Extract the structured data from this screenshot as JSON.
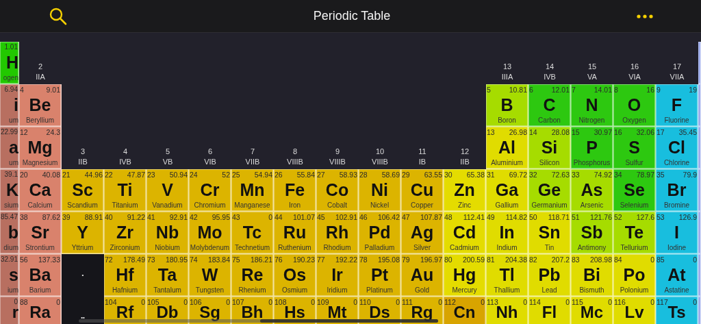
{
  "top_bar": {
    "title": "Periodic Table"
  },
  "rows": [
    {
      "cells": [
        {
          "kind": "edge",
          "mass": "1.01",
          "symbol": "H",
          "name": "ogen",
          "color": "#22c800"
        },
        {
          "kind": "label",
          "number": "2",
          "roman": "IIA"
        },
        {
          "kind": "gap"
        },
        {
          "kind": "gap"
        },
        {
          "kind": "gap"
        },
        {
          "kind": "gap"
        },
        {
          "kind": "gap"
        },
        {
          "kind": "gap"
        },
        {
          "kind": "gap"
        },
        {
          "kind": "gap"
        },
        {
          "kind": "gap"
        },
        {
          "kind": "gap"
        },
        {
          "kind": "label",
          "number": "13",
          "roman": "IIIA"
        },
        {
          "kind": "label",
          "number": "14",
          "roman": "IVB"
        },
        {
          "kind": "label",
          "number": "15",
          "roman": "VA"
        },
        {
          "kind": "label",
          "number": "16",
          "roman": "VIA"
        },
        {
          "kind": "label",
          "number": "17",
          "roman": "VIIA"
        },
        {
          "kind": "sliver",
          "color": "#8a9ce8"
        }
      ]
    },
    {
      "cells": [
        {
          "kind": "edge",
          "mass": "6.94",
          "symbol": "i",
          "name": "um",
          "color": "#b86f60"
        },
        {
          "kind": "element",
          "number": "4",
          "mass": "9.01",
          "symbol": "Be",
          "name": "Beryllium",
          "color": "#d9826c"
        },
        {
          "kind": "gap"
        },
        {
          "kind": "gap"
        },
        {
          "kind": "gap"
        },
        {
          "kind": "gap"
        },
        {
          "kind": "gap"
        },
        {
          "kind": "gap"
        },
        {
          "kind": "gap"
        },
        {
          "kind": "gap"
        },
        {
          "kind": "gap"
        },
        {
          "kind": "gap"
        },
        {
          "kind": "element",
          "number": "5",
          "mass": "10.81",
          "symbol": "B",
          "name": "Boron",
          "color": "#a6dc00"
        },
        {
          "kind": "element",
          "number": "6",
          "mass": "12.01",
          "symbol": "C",
          "name": "Carbon",
          "color": "#2dc810"
        },
        {
          "kind": "element",
          "number": "7",
          "mass": "14.01",
          "symbol": "N",
          "name": "Nitrogen",
          "color": "#2dc810"
        },
        {
          "kind": "element",
          "number": "8",
          "mass": "16",
          "symbol": "O",
          "name": "Oxygen",
          "color": "#2dc810"
        },
        {
          "kind": "element",
          "number": "9",
          "mass": "19",
          "symbol": "F",
          "name": "Fluorine",
          "color": "#18bede"
        },
        {
          "kind": "sliver",
          "color": "#8a9ce8"
        }
      ]
    },
    {
      "cells": [
        {
          "kind": "edge",
          "mass": "22.99",
          "symbol": "a",
          "name": "um",
          "color": "#b86f60"
        },
        {
          "kind": "element",
          "number": "12",
          "mass": "24.3",
          "symbol": "Mg",
          "name": "Magnesium",
          "color": "#d9826c"
        },
        {
          "kind": "label",
          "number": "3",
          "roman": "IIB"
        },
        {
          "kind": "label",
          "number": "4",
          "roman": "IVB"
        },
        {
          "kind": "label",
          "number": "5",
          "roman": "VB"
        },
        {
          "kind": "label",
          "number": "6",
          "roman": "VIB"
        },
        {
          "kind": "label",
          "number": "7",
          "roman": "VIIB"
        },
        {
          "kind": "label",
          "number": "8",
          "roman": "VIIIB"
        },
        {
          "kind": "label",
          "number": "9",
          "roman": "VIIIB"
        },
        {
          "kind": "label",
          "number": "10",
          "roman": "VIIIB"
        },
        {
          "kind": "label",
          "number": "11",
          "roman": "IB"
        },
        {
          "kind": "label",
          "number": "12",
          "roman": "IIB"
        },
        {
          "kind": "element",
          "number": "13",
          "mass": "26.98",
          "symbol": "Al",
          "name": "Aluminium",
          "color": "#e0dc00"
        },
        {
          "kind": "element",
          "number": "14",
          "mass": "28.08",
          "symbol": "Si",
          "name": "Silicon",
          "color": "#a6dc00"
        },
        {
          "kind": "element",
          "number": "15",
          "mass": "30.97",
          "symbol": "P",
          "name": "Phosphorus",
          "color": "#2dc810"
        },
        {
          "kind": "element",
          "number": "16",
          "mass": "32.06",
          "symbol": "S",
          "name": "Sulfur",
          "color": "#2dc810"
        },
        {
          "kind": "element",
          "number": "17",
          "mass": "35.45",
          "symbol": "Cl",
          "name": "Chlorine",
          "color": "#18bede"
        },
        {
          "kind": "sliver",
          "color": "#8a9ce8"
        }
      ]
    },
    {
      "cells": [
        {
          "kind": "edge",
          "mass": "39.1",
          "symbol": "K",
          "name": "sium",
          "color": "#b86f60"
        },
        {
          "kind": "element",
          "number": "20",
          "mass": "40.08",
          "symbol": "Ca",
          "name": "Calcium",
          "color": "#d9826c"
        },
        {
          "kind": "element",
          "number": "21",
          "mass": "44.96",
          "symbol": "Sc",
          "name": "Scandium",
          "color": "#dcb400"
        },
        {
          "kind": "element",
          "number": "22",
          "mass": "47.87",
          "symbol": "Ti",
          "name": "Titanium",
          "color": "#dcb400"
        },
        {
          "kind": "element",
          "number": "23",
          "mass": "50.94",
          "symbol": "V",
          "name": "Vanadium",
          "color": "#dcb400"
        },
        {
          "kind": "element",
          "number": "24",
          "mass": "52",
          "symbol": "Cr",
          "name": "Chromium",
          "color": "#dcb400"
        },
        {
          "kind": "element",
          "number": "25",
          "mass": "54.94",
          "symbol": "Mn",
          "name": "Manganese",
          "color": "#dcb400"
        },
        {
          "kind": "element",
          "number": "26",
          "mass": "55.84",
          "symbol": "Fe",
          "name": "Iron",
          "color": "#dcb400"
        },
        {
          "kind": "element",
          "number": "27",
          "mass": "58.93",
          "symbol": "Co",
          "name": "Cobalt",
          "color": "#dcb400"
        },
        {
          "kind": "element",
          "number": "28",
          "mass": "58.69",
          "symbol": "Ni",
          "name": "Nickel",
          "color": "#dcb400"
        },
        {
          "kind": "element",
          "number": "29",
          "mass": "63.55",
          "symbol": "Cu",
          "name": "Copper",
          "color": "#dcb400"
        },
        {
          "kind": "element",
          "number": "30",
          "mass": "65.38",
          "symbol": "Zn",
          "name": "Zinc",
          "color": "#e4dc00"
        },
        {
          "kind": "element",
          "number": "31",
          "mass": "69.72",
          "symbol": "Ga",
          "name": "Gallium",
          "color": "#e0dc00"
        },
        {
          "kind": "element",
          "number": "32",
          "mass": "72.63",
          "symbol": "Ge",
          "name": "Germanium",
          "color": "#a6dc00"
        },
        {
          "kind": "element",
          "number": "33",
          "mass": "74.92",
          "symbol": "As",
          "name": "Arsenic",
          "color": "#a6dc00"
        },
        {
          "kind": "element",
          "number": "34",
          "mass": "78.97",
          "symbol": "Se",
          "name": "Selenium",
          "color": "#2dc810"
        },
        {
          "kind": "element",
          "number": "35",
          "mass": "79.9",
          "symbol": "Br",
          "name": "Bromine",
          "color": "#18bede"
        },
        {
          "kind": "sliver",
          "color": "#8a9ce8"
        }
      ]
    },
    {
      "cells": [
        {
          "kind": "edge",
          "mass": "85.47",
          "symbol": "b",
          "name": "dium",
          "color": "#b86f60"
        },
        {
          "kind": "element",
          "number": "38",
          "mass": "87.62",
          "symbol": "Sr",
          "name": "Strontium",
          "color": "#d9826c"
        },
        {
          "kind": "element",
          "number": "39",
          "mass": "88.91",
          "symbol": "Y",
          "name": "Yttrium",
          "color": "#dcb400"
        },
        {
          "kind": "element",
          "number": "40",
          "mass": "91.22",
          "symbol": "Zr",
          "name": "Zirconium",
          "color": "#dcb400"
        },
        {
          "kind": "element",
          "number": "41",
          "mass": "92.91",
          "symbol": "Nb",
          "name": "Niobium",
          "color": "#dcb400"
        },
        {
          "kind": "element",
          "number": "42",
          "mass": "95.95",
          "symbol": "Mo",
          "name": "Molybdenum",
          "color": "#dcb400"
        },
        {
          "kind": "element",
          "number": "43",
          "mass": "0",
          "symbol": "Tc",
          "name": "Technetium",
          "color": "#dcb400"
        },
        {
          "kind": "element",
          "number": "44",
          "mass": "101.07",
          "symbol": "Ru",
          "name": "Ruthenium",
          "color": "#dcb400"
        },
        {
          "kind": "element",
          "number": "45",
          "mass": "102.91",
          "symbol": "Rh",
          "name": "Rhodium",
          "color": "#dcb400"
        },
        {
          "kind": "element",
          "number": "46",
          "mass": "106.42",
          "symbol": "Pd",
          "name": "Palladium",
          "color": "#dcb400"
        },
        {
          "kind": "element",
          "number": "47",
          "mass": "107.87",
          "symbol": "Ag",
          "name": "Silver",
          "color": "#dcb400"
        },
        {
          "kind": "element",
          "number": "48",
          "mass": "112.41",
          "symbol": "Cd",
          "name": "Cadmium",
          "color": "#e4dc00"
        },
        {
          "kind": "element",
          "number": "49",
          "mass": "114.82",
          "symbol": "In",
          "name": "Indium",
          "color": "#e0dc00"
        },
        {
          "kind": "element",
          "number": "50",
          "mass": "118.71",
          "symbol": "Sn",
          "name": "Tin",
          "color": "#e0dc00"
        },
        {
          "kind": "element",
          "number": "51",
          "mass": "121.76",
          "symbol": "Sb",
          "name": "Antimony",
          "color": "#a6dc00"
        },
        {
          "kind": "element",
          "number": "52",
          "mass": "127.6",
          "symbol": "Te",
          "name": "Tellurium",
          "color": "#a6dc00"
        },
        {
          "kind": "element",
          "number": "53",
          "mass": "126.9",
          "symbol": "I",
          "name": "Iodine",
          "color": "#18bede"
        },
        {
          "kind": "sliver",
          "color": "#8a9ce8"
        }
      ]
    },
    {
      "cells": [
        {
          "kind": "edge",
          "mass": "32.91",
          "symbol": "s",
          "name": "ium",
          "color": "#b86f60"
        },
        {
          "kind": "element",
          "number": "56",
          "mass": "137.33",
          "symbol": "Ba",
          "name": "Barium",
          "color": "#d9826c"
        },
        {
          "kind": "placeholder",
          "mark": "•"
        },
        {
          "kind": "element",
          "number": "72",
          "mass": "178.49",
          "symbol": "Hf",
          "name": "Hafnium",
          "color": "#dcb400"
        },
        {
          "kind": "element",
          "number": "73",
          "mass": "180.95",
          "symbol": "Ta",
          "name": "Tantalum",
          "color": "#dcb400"
        },
        {
          "kind": "element",
          "number": "74",
          "mass": "183.84",
          "symbol": "W",
          "name": "Tungsten",
          "color": "#dcb400"
        },
        {
          "kind": "element",
          "number": "75",
          "mass": "186.21",
          "symbol": "Re",
          "name": "Rhenium",
          "color": "#dcb400"
        },
        {
          "kind": "element",
          "number": "76",
          "mass": "190.23",
          "symbol": "Os",
          "name": "Osmium",
          "color": "#dcb400"
        },
        {
          "kind": "element",
          "number": "77",
          "mass": "192.22",
          "symbol": "Ir",
          "name": "Iridium",
          "color": "#dcb400"
        },
        {
          "kind": "element",
          "number": "78",
          "mass": "195.08",
          "symbol": "Pt",
          "name": "Platinum",
          "color": "#dcb400"
        },
        {
          "kind": "element",
          "number": "79",
          "mass": "196.97",
          "symbol": "Au",
          "name": "Gold",
          "color": "#dcb400"
        },
        {
          "kind": "element",
          "number": "80",
          "mass": "200.59",
          "symbol": "Hg",
          "name": "Mercury",
          "color": "#e4dc00"
        },
        {
          "kind": "element",
          "number": "81",
          "mass": "204.38",
          "symbol": "Tl",
          "name": "Thallium",
          "color": "#e0dc00"
        },
        {
          "kind": "element",
          "number": "82",
          "mass": "207.2",
          "symbol": "Pb",
          "name": "Lead",
          "color": "#e0dc00"
        },
        {
          "kind": "element",
          "number": "83",
          "mass": "208.98",
          "symbol": "Bi",
          "name": "Bismuth",
          "color": "#e0dc00"
        },
        {
          "kind": "element",
          "number": "84",
          "mass": "0",
          "symbol": "Po",
          "name": "Polonium",
          "color": "#e0dc00"
        },
        {
          "kind": "element",
          "number": "85",
          "mass": "0",
          "symbol": "At",
          "name": "Astatine",
          "color": "#18bede"
        },
        {
          "kind": "sliver",
          "color": "#8a9ce8"
        }
      ]
    },
    {
      "cells": [
        {
          "kind": "edge",
          "mass": "0",
          "symbol": "r",
          "color": "#b86f60"
        },
        {
          "kind": "element",
          "number": "88",
          "mass": "0",
          "symbol": "Ra",
          "color": "#d9826c"
        },
        {
          "kind": "placeholder",
          "mark": "••"
        },
        {
          "kind": "element",
          "number": "104",
          "mass": "0",
          "symbol": "Rf",
          "color": "#dcb400"
        },
        {
          "kind": "element",
          "number": "105",
          "mass": "0",
          "symbol": "Db",
          "color": "#dcb400"
        },
        {
          "kind": "element",
          "number": "106",
          "mass": "0",
          "symbol": "Sg",
          "color": "#dcb400"
        },
        {
          "kind": "element",
          "number": "107",
          "mass": "0",
          "symbol": "Bh",
          "color": "#dcb400"
        },
        {
          "kind": "element",
          "number": "108",
          "mass": "0",
          "symbol": "Hs",
          "color": "#dcb400"
        },
        {
          "kind": "element",
          "number": "109",
          "mass": "0",
          "symbol": "Mt",
          "color": "#dcb400"
        },
        {
          "kind": "element",
          "number": "110",
          "mass": "0",
          "symbol": "Ds",
          "color": "#dcb400"
        },
        {
          "kind": "element",
          "number": "111",
          "mass": "0",
          "symbol": "Rg",
          "color": "#dcb400"
        },
        {
          "kind": "element",
          "number": "112",
          "mass": "0",
          "symbol": "Cn",
          "color": "#d8a400"
        },
        {
          "kind": "element",
          "number": "113",
          "mass": "0",
          "symbol": "Nh",
          "color": "#e0dc00"
        },
        {
          "kind": "element",
          "number": "114",
          "mass": "0",
          "symbol": "Fl",
          "color": "#e0dc00"
        },
        {
          "kind": "element",
          "number": "115",
          "mass": "0",
          "symbol": "Mc",
          "color": "#e0dc00"
        },
        {
          "kind": "element",
          "number": "116",
          "mass": "0",
          "symbol": "Lv",
          "color": "#e0dc00"
        },
        {
          "kind": "element",
          "number": "117",
          "mass": "0",
          "symbol": "Ts",
          "color": "#18bede"
        },
        {
          "kind": "sliver",
          "color": "#8a9ce8"
        }
      ]
    }
  ]
}
